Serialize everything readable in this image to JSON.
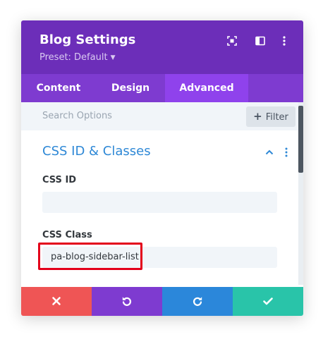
{
  "header": {
    "title": "Blog Settings",
    "preset_label": "Preset: Default",
    "icons": [
      "fullscreen-icon",
      "sidebar-toggle-icon",
      "more-options-icon"
    ]
  },
  "tabs": [
    {
      "label": "Content",
      "active": false
    },
    {
      "label": "Design",
      "active": false
    },
    {
      "label": "Advanced",
      "active": true
    }
  ],
  "search": {
    "placeholder": "Search Options",
    "filter_label": "Filter"
  },
  "section": {
    "title": "CSS ID & Classes",
    "expanded": true
  },
  "fields": {
    "css_id": {
      "label": "CSS ID",
      "value": ""
    },
    "css_class": {
      "label": "CSS Class",
      "value": "pa-blog-sidebar-list"
    }
  },
  "footer": {
    "buttons": [
      "cancel",
      "undo",
      "redo",
      "save"
    ]
  },
  "colors": {
    "header_bg": "#6c2eb9",
    "tabs_bg": "#7e3bd0",
    "active_tab_bg": "#8f42ec",
    "section_title": "#2e88d6",
    "highlight": "#e3001b",
    "cancel": "#ef5555",
    "undo": "#7e3bd0",
    "redo": "#2b87da",
    "save": "#29c4a9"
  }
}
